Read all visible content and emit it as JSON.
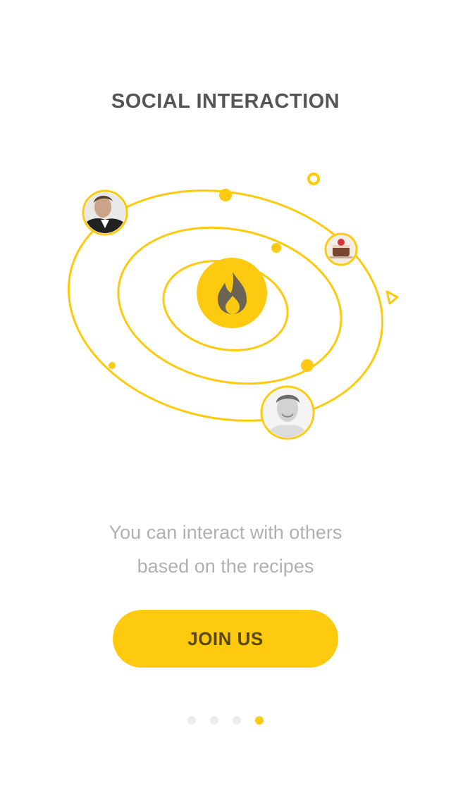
{
  "screen": {
    "title": "SOCIAL INTERACTION",
    "description_line1": "You can interact with others",
    "description_line2": "based on the recipes",
    "join_label": "JOIN US"
  },
  "pagination": {
    "total": 4,
    "active_index": 3
  },
  "colors": {
    "accent": "#fdca0f",
    "title_text": "#555555",
    "body_text": "#b0b0b0",
    "button_text": "#5a4700",
    "inactive_dot": "#ececec"
  },
  "icons": {
    "center": "flame-icon",
    "avatars": [
      "man-in-suit-avatar",
      "cake-dessert-avatar",
      "smiling-man-avatar"
    ]
  }
}
